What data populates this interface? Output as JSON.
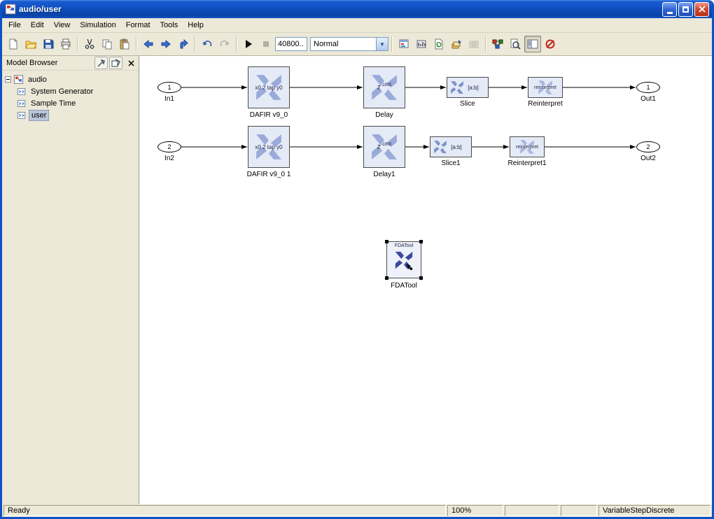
{
  "window": {
    "title": "audio/user"
  },
  "menu": {
    "items": [
      "File",
      "Edit",
      "View",
      "Simulation",
      "Format",
      "Tools",
      "Help"
    ]
  },
  "toolbar": {
    "sim_time": "40800...",
    "sim_mode": "Normal"
  },
  "model_browser": {
    "title": "Model Browser",
    "root": "audio",
    "items": [
      "System Generator",
      "Sample Time",
      "user"
    ],
    "selected": "user"
  },
  "diagram": {
    "in1": {
      "port": "1",
      "label": "In1"
    },
    "in2": {
      "port": "2",
      "label": "In2"
    },
    "out1": {
      "port": "1",
      "label": "Out1"
    },
    "out2": {
      "port": "2",
      "label": "Out2"
    },
    "dafir1": {
      "text": "x0 2 tap y0",
      "label": "DAFIR v9_0"
    },
    "dafir2": {
      "text": "x0 2 tap y0",
      "label": "DAFIR v9_0 1"
    },
    "delay1": {
      "base": "z",
      "exp": "-1800",
      "label": "Delay"
    },
    "delay2": {
      "base": "z",
      "exp": "-1800",
      "label": "Delay1"
    },
    "slice1": {
      "text": "[a:b]",
      "label": "Slice"
    },
    "slice2": {
      "text": "[a:b]",
      "label": "Slice1"
    },
    "reinterpret1": {
      "text": "reinterpret",
      "label": "Reinterpret"
    },
    "reinterpret2": {
      "text": "reinterpret",
      "label": "Reinterpret1"
    },
    "fdatool": {
      "text": "FDATool",
      "label": "FDATool"
    }
  },
  "status": {
    "ready": "Ready",
    "zoom": "100%",
    "solver": "VariableStepDiscrete"
  },
  "colors": {
    "titlebar_blue": "#0f4fc1",
    "close_red": "#d6492f",
    "block_fill": "#e4eaf6",
    "logo_blue": "#5a6db8",
    "selection": "#b8c7d8",
    "canvas": "#ffffff"
  },
  "icons": {
    "new": "blank-page",
    "open": "folder",
    "save": "floppy-disk",
    "print": "printer",
    "cut": "scissors",
    "copy": "two-pages",
    "paste": "clipboard",
    "back": "left-arrow",
    "forward": "right-arrow",
    "up": "up-bent-arrow",
    "undo": "curved-left-arrow",
    "redo": "curved-right-arrow",
    "start": "play-triangle",
    "stop": "square",
    "library": "colored-blocks",
    "find": "magnifier",
    "model_browser": "panel-layout",
    "target": "red-knot"
  }
}
